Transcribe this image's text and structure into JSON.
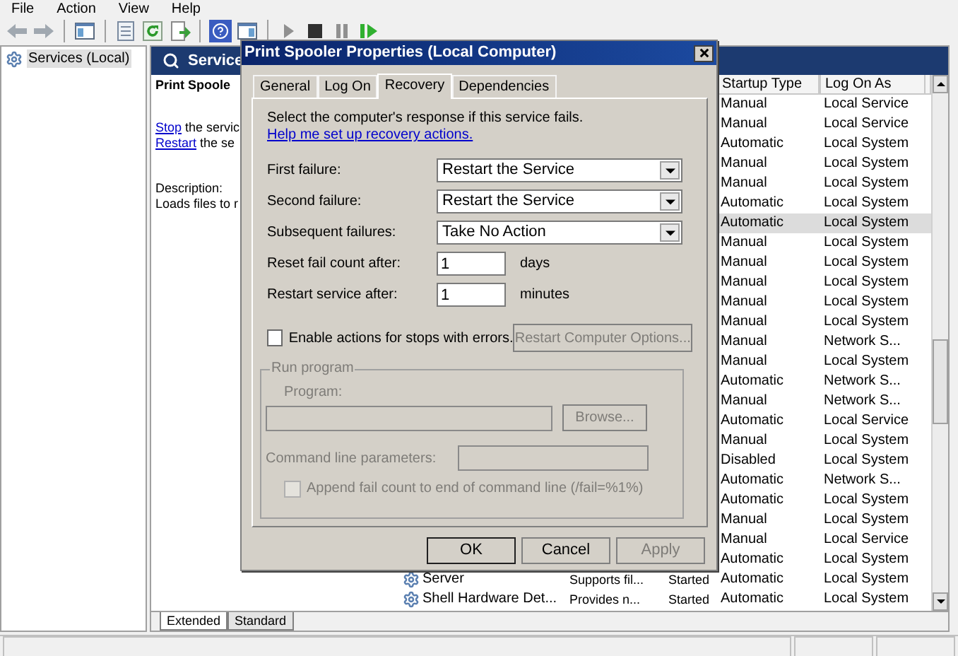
{
  "menu_bar": [
    "File",
    "Action",
    "View",
    "Help"
  ],
  "tree": {
    "items": [
      {
        "label": "Services (Local)",
        "selected": true
      }
    ]
  },
  "services_panel": {
    "header": "Service",
    "service_name": "Print Spoole",
    "actions": [
      {
        "link": "Stop",
        "text": "the servic"
      },
      {
        "link": "Restart",
        "text": "the se"
      }
    ],
    "description_label": "Description:",
    "description": "Loads files to r"
  },
  "services_table": {
    "columns": [
      "Startup Type",
      "Log On As"
    ],
    "rows": [
      {
        "startup_type": "Manual",
        "log_on_as": "Local Service",
        "selected": false
      },
      {
        "startup_type": "Manual",
        "log_on_as": "Local Service",
        "selected": false
      },
      {
        "startup_type": "Automatic",
        "log_on_as": "Local System",
        "selected": false
      },
      {
        "startup_type": "Manual",
        "log_on_as": "Local System",
        "selected": false
      },
      {
        "startup_type": "Manual",
        "log_on_as": "Local System",
        "selected": false
      },
      {
        "startup_type": "Automatic",
        "log_on_as": "Local System",
        "selected": false
      },
      {
        "startup_type": "Automatic",
        "log_on_as": "Local System",
        "selected": true
      },
      {
        "startup_type": "Manual",
        "log_on_as": "Local System",
        "selected": false
      },
      {
        "startup_type": "Manual",
        "log_on_as": "Local System",
        "selected": false
      },
      {
        "startup_type": "Manual",
        "log_on_as": "Local System",
        "selected": false
      },
      {
        "startup_type": "Manual",
        "log_on_as": "Local System",
        "selected": false
      },
      {
        "startup_type": "Manual",
        "log_on_as": "Local System",
        "selected": false
      },
      {
        "startup_type": "Manual",
        "log_on_as": "Network S...",
        "selected": false
      },
      {
        "startup_type": "Manual",
        "log_on_as": "Local System",
        "selected": false
      },
      {
        "startup_type": "Automatic",
        "log_on_as": "Network S...",
        "selected": false
      },
      {
        "startup_type": "Manual",
        "log_on_as": "Network S...",
        "selected": false
      },
      {
        "startup_type": "Automatic",
        "log_on_as": "Local Service",
        "selected": false
      },
      {
        "startup_type": "Manual",
        "log_on_as": "Local System",
        "selected": false
      },
      {
        "startup_type": "Disabled",
        "log_on_as": "Local System",
        "selected": false
      },
      {
        "startup_type": "Automatic",
        "log_on_as": "Network S...",
        "selected": false
      },
      {
        "startup_type": "Automatic",
        "log_on_as": "Local System",
        "selected": false
      },
      {
        "startup_type": "Manual",
        "log_on_as": "Local System",
        "selected": false
      },
      {
        "startup_type": "Manual",
        "log_on_as": "Local Service",
        "selected": false
      },
      {
        "startup_type": "Automatic",
        "log_on_as": "Local System",
        "selected": false
      },
      {
        "name": "Server",
        "description": "Supports fil...",
        "status": "Started",
        "startup_type": "Automatic",
        "log_on_as": "Local System",
        "selected": false
      },
      {
        "name": "Shell Hardware Det...",
        "description": "Provides n...",
        "status": "Started",
        "startup_type": "Automatic",
        "log_on_as": "Local System",
        "selected": false
      }
    ]
  },
  "view_tabs": [
    {
      "label": "Extended",
      "selected": true
    },
    {
      "label": "Standard",
      "selected": false
    }
  ],
  "dialog": {
    "title": "Print Spooler Properties (Local Computer)",
    "tabs": [
      {
        "label": "General",
        "selected": false
      },
      {
        "label": "Log On",
        "selected": false
      },
      {
        "label": "Recovery",
        "selected": true
      },
      {
        "label": "Dependencies",
        "selected": false
      }
    ],
    "intro": "Select the computer's response if this service fails.",
    "help_link": "Help me set up recovery actions.",
    "failures": [
      {
        "label": "First failure:",
        "value": "Restart the Service"
      },
      {
        "label": "Second failure:",
        "value": "Restart the Service"
      },
      {
        "label": "Subsequent failures:",
        "value": "Take No Action"
      }
    ],
    "counters": [
      {
        "label": "Reset fail count after:",
        "value": "1",
        "unit": "days"
      },
      {
        "label": "Restart service after:",
        "value": "1",
        "unit": "minutes"
      }
    ],
    "enable_stops": {
      "label": "Enable actions for stops with errors.",
      "checked": false
    },
    "restart_computer_button": {
      "label": "Restart Computer Options...",
      "disabled": true
    },
    "run_program": {
      "title": "Run program",
      "disabled": true,
      "program_label": "Program:",
      "browse_button": "Browse...",
      "params_label": "Command line parameters:",
      "append": {
        "label": "Append fail count to end of command line (/fail=%1%)",
        "checked": false
      }
    },
    "buttons": [
      {
        "label": "OK",
        "disabled": false
      },
      {
        "label": "Cancel",
        "disabled": false
      },
      {
        "label": "Apply",
        "disabled": true
      }
    ]
  }
}
